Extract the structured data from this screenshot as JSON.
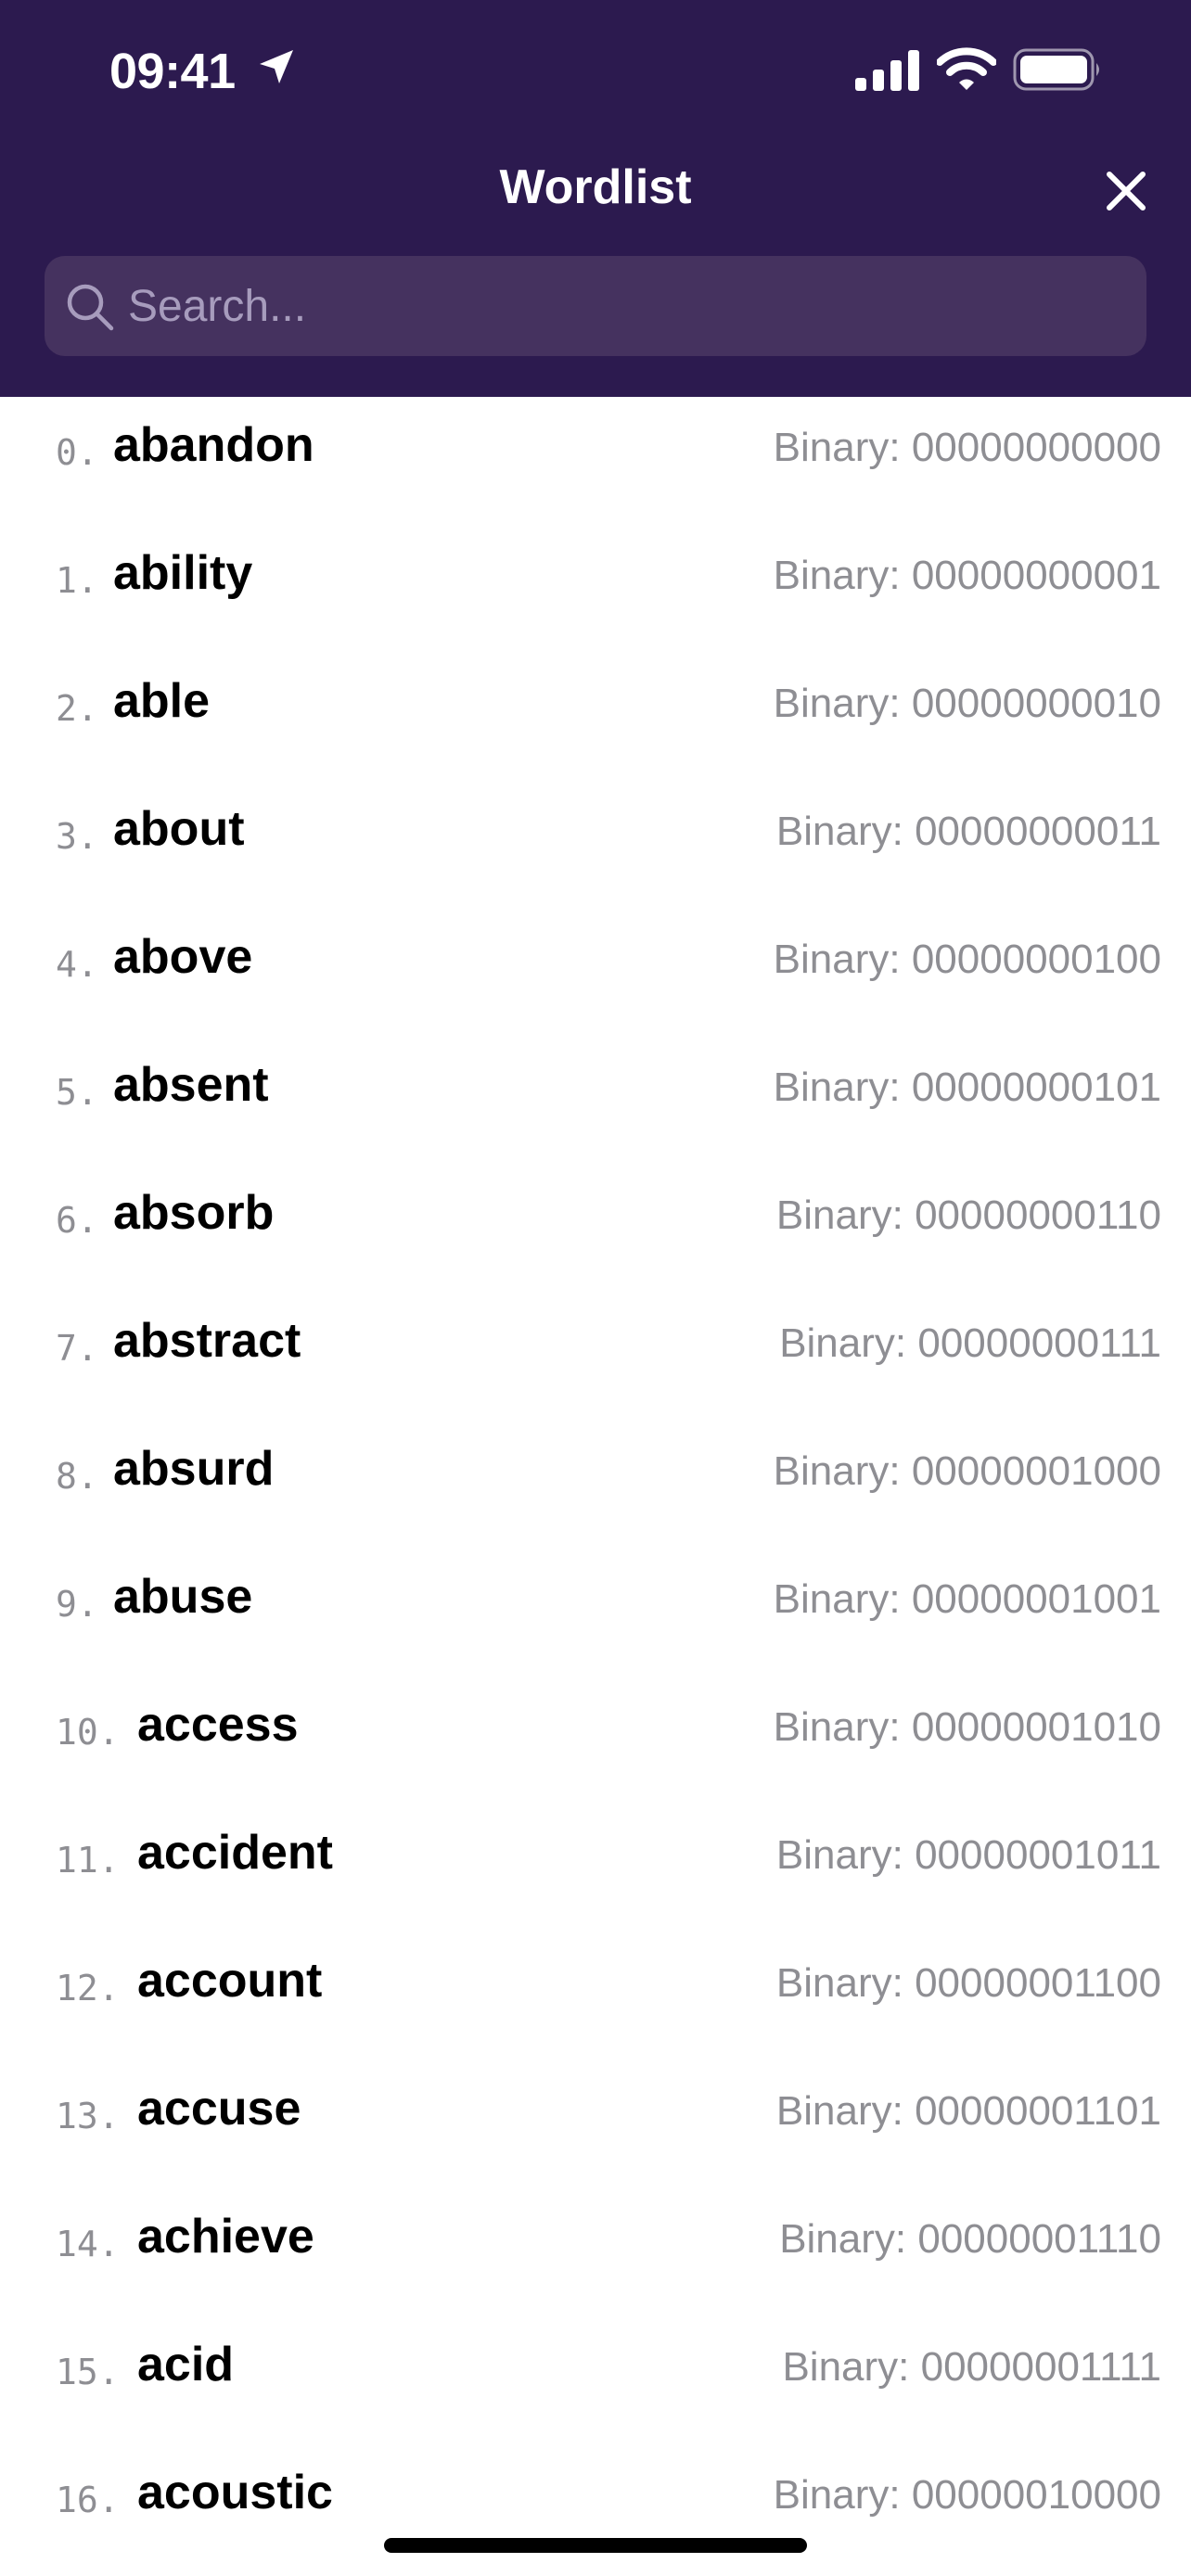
{
  "status_bar": {
    "time": "09:41",
    "icons": [
      "location-arrow-icon",
      "cellular-signal-icon",
      "wifi-icon",
      "battery-icon"
    ]
  },
  "nav": {
    "title": "Wordlist",
    "close_icon": "close-icon"
  },
  "search": {
    "placeholder": "Search...",
    "value": "",
    "icon": "search-icon"
  },
  "colors": {
    "header_bg": "#2c1a4f",
    "search_bg": "#45325f",
    "secondary_text": "#8e8e93"
  },
  "binary_prefix": "Binary: ",
  "words": [
    {
      "index": "0.",
      "word": "abandon",
      "binary": "Binary: 00000000000"
    },
    {
      "index": "1.",
      "word": "ability",
      "binary": "Binary: 00000000001"
    },
    {
      "index": "2.",
      "word": "able",
      "binary": "Binary: 00000000010"
    },
    {
      "index": "3.",
      "word": "about",
      "binary": "Binary: 00000000011"
    },
    {
      "index": "4.",
      "word": "above",
      "binary": "Binary: 00000000100"
    },
    {
      "index": "5.",
      "word": "absent",
      "binary": "Binary: 00000000101"
    },
    {
      "index": "6.",
      "word": "absorb",
      "binary": "Binary: 00000000110"
    },
    {
      "index": "7.",
      "word": "abstract",
      "binary": "Binary: 00000000111"
    },
    {
      "index": "8.",
      "word": "absurd",
      "binary": "Binary: 00000001000"
    },
    {
      "index": "9.",
      "word": "abuse",
      "binary": "Binary: 00000001001"
    },
    {
      "index": "10.",
      "word": "access",
      "binary": "Binary: 00000001010"
    },
    {
      "index": "11.",
      "word": "accident",
      "binary": "Binary: 00000001011"
    },
    {
      "index": "12.",
      "word": "account",
      "binary": "Binary: 00000001100"
    },
    {
      "index": "13.",
      "word": "accuse",
      "binary": "Binary: 00000001101"
    },
    {
      "index": "14.",
      "word": "achieve",
      "binary": "Binary: 00000001110"
    },
    {
      "index": "15.",
      "word": "acid",
      "binary": "Binary: 00000001111"
    },
    {
      "index": "16.",
      "word": "acoustic",
      "binary": "Binary: 00000010000"
    }
  ]
}
